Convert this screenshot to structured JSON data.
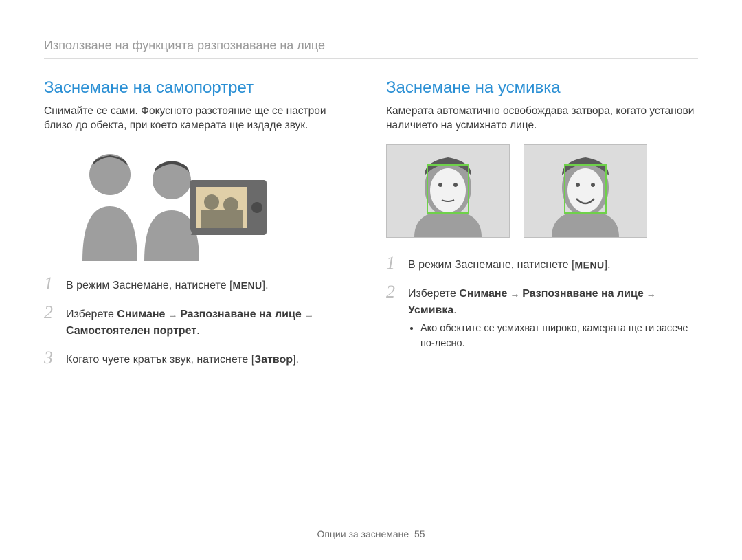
{
  "breadcrumb": "Използване на функцията разпознаване на лице",
  "left": {
    "heading": "Заснемане на самопортрет",
    "intro": "Снимайте се сами. Фокусното разстояние ще се настрои близо до обекта, при което камерата ще издаде звук.",
    "steps": {
      "s1": {
        "no": "1",
        "pre": "В режим Заснемане, натиснете [",
        "menu": "MENU",
        "post": "]."
      },
      "s2": {
        "no": "2",
        "pre": "Изберете ",
        "b1": "Снимане",
        "arrow1": " → ",
        "b2": "Разпознаване на лице",
        "arrow2": " → ",
        "b3": "Самостоятелен портрет",
        "post": "."
      },
      "s3": {
        "no": "3",
        "pre": "Когато чуете кратък звук, натиснете [",
        "b1": "Затвор",
        "post": "]."
      }
    }
  },
  "right": {
    "heading": "Заснемане на усмивка",
    "intro": "Камерата автоматично освобождава затвора, когато установи наличието на усмихнато лице.",
    "steps": {
      "s1": {
        "no": "1",
        "pre": "В режим Заснемане, натиснете [",
        "menu": "MENU",
        "post": "]."
      },
      "s2": {
        "no": "2",
        "pre": "Изберете ",
        "b1": "Снимане",
        "arrow1": " → ",
        "b2": "Разпознаване на лице",
        "arrow2": " → ",
        "b3": "Усмивка",
        "post": "."
      },
      "note": "Ако обектите се усмихват широко, камерата ще ги засече по-лесно."
    }
  },
  "footer": {
    "label": "Опции за заснемане",
    "page": "55"
  }
}
